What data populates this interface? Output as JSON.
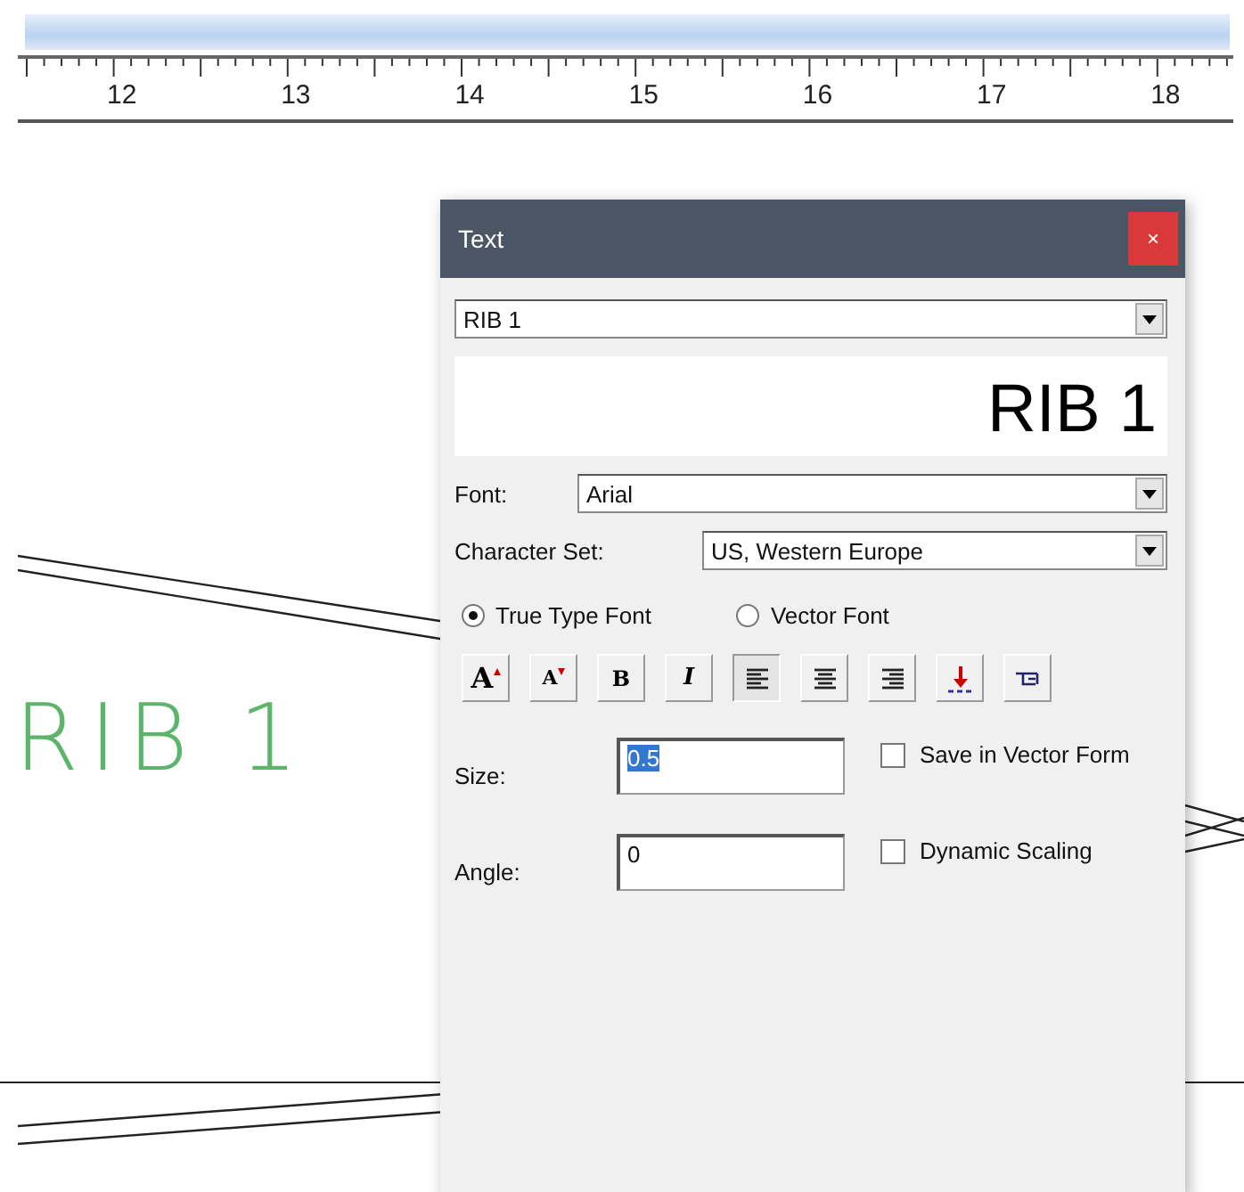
{
  "ruler": {
    "labels": [
      "12",
      "13",
      "14",
      "15",
      "16",
      "17",
      "18"
    ]
  },
  "canvas": {
    "label": "RIB 1"
  },
  "dialog": {
    "title": "Text",
    "close": "×",
    "text_select": {
      "value": "RIB 1"
    },
    "preview": "RIB 1",
    "font": {
      "label": "Font:",
      "value": "Arial"
    },
    "charset": {
      "label": "Character Set:",
      "value": "US, Western Europe"
    },
    "font_types": [
      {
        "label": "True Type Font",
        "selected": true
      },
      {
        "label": "Vector Font",
        "selected": false
      }
    ],
    "toolbar": [
      {
        "kind": "grow",
        "label": "A",
        "selected": false
      },
      {
        "kind": "shrink",
        "label": "A",
        "selected": false
      },
      {
        "kind": "bold",
        "label": "B",
        "selected": false
      },
      {
        "kind": "italic",
        "label": "I",
        "selected": false
      },
      {
        "kind": "align-left",
        "selected": true
      },
      {
        "kind": "align-center",
        "selected": false
      },
      {
        "kind": "align-right",
        "selected": false
      },
      {
        "kind": "baseline",
        "selected": false
      },
      {
        "kind": "pointer",
        "selected": false
      }
    ],
    "size": {
      "label": "Size:",
      "value": "0.5",
      "highlighted": true
    },
    "angle": {
      "label": "Angle:",
      "value": "0",
      "highlighted": false
    },
    "options": [
      {
        "label": "Save in Vector Form",
        "checked": false
      },
      {
        "label": "Dynamic Scaling",
        "checked": false
      }
    ]
  }
}
